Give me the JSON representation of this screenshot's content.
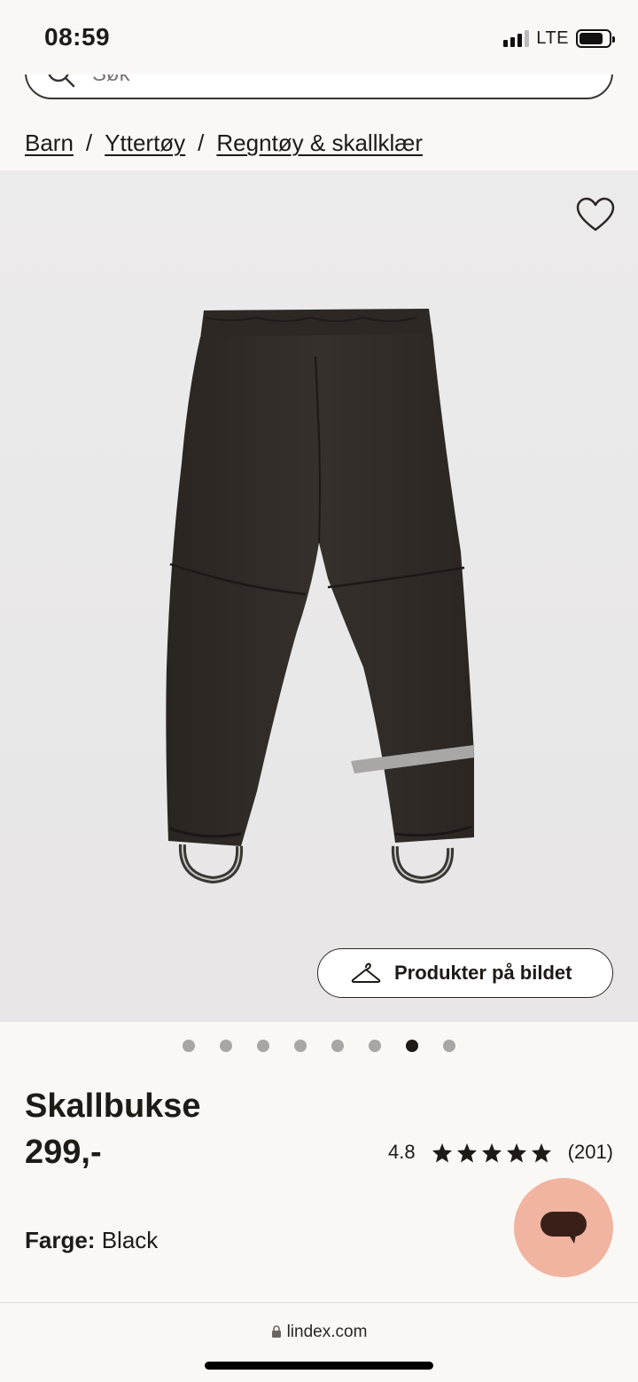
{
  "status_bar": {
    "time": "08:59",
    "network": "LTE"
  },
  "search": {
    "placeholder": "Søk"
  },
  "breadcrumb": {
    "items": [
      "Barn",
      "Yttertøy",
      "Regntøy & skallklær"
    ],
    "separator": "/"
  },
  "image": {
    "products_button_label": "Produkter på bildet",
    "dots_total": 8,
    "dots_active_index": 6
  },
  "product": {
    "title": "Skallbukse",
    "price": "299,-",
    "rating_score": "4.8",
    "stars": 5,
    "review_count": "(201)",
    "color_label": "Farge:",
    "color_value": "Black"
  },
  "browser": {
    "url": "lindex.com"
  },
  "colors": {
    "background": "#faf8f4",
    "chat_button": "#f0b4a0",
    "text": "#1e1a16"
  },
  "icons": [
    "search-icon",
    "heart-icon",
    "hanger-icon",
    "star-icon",
    "chat-icon",
    "lock-icon"
  ]
}
